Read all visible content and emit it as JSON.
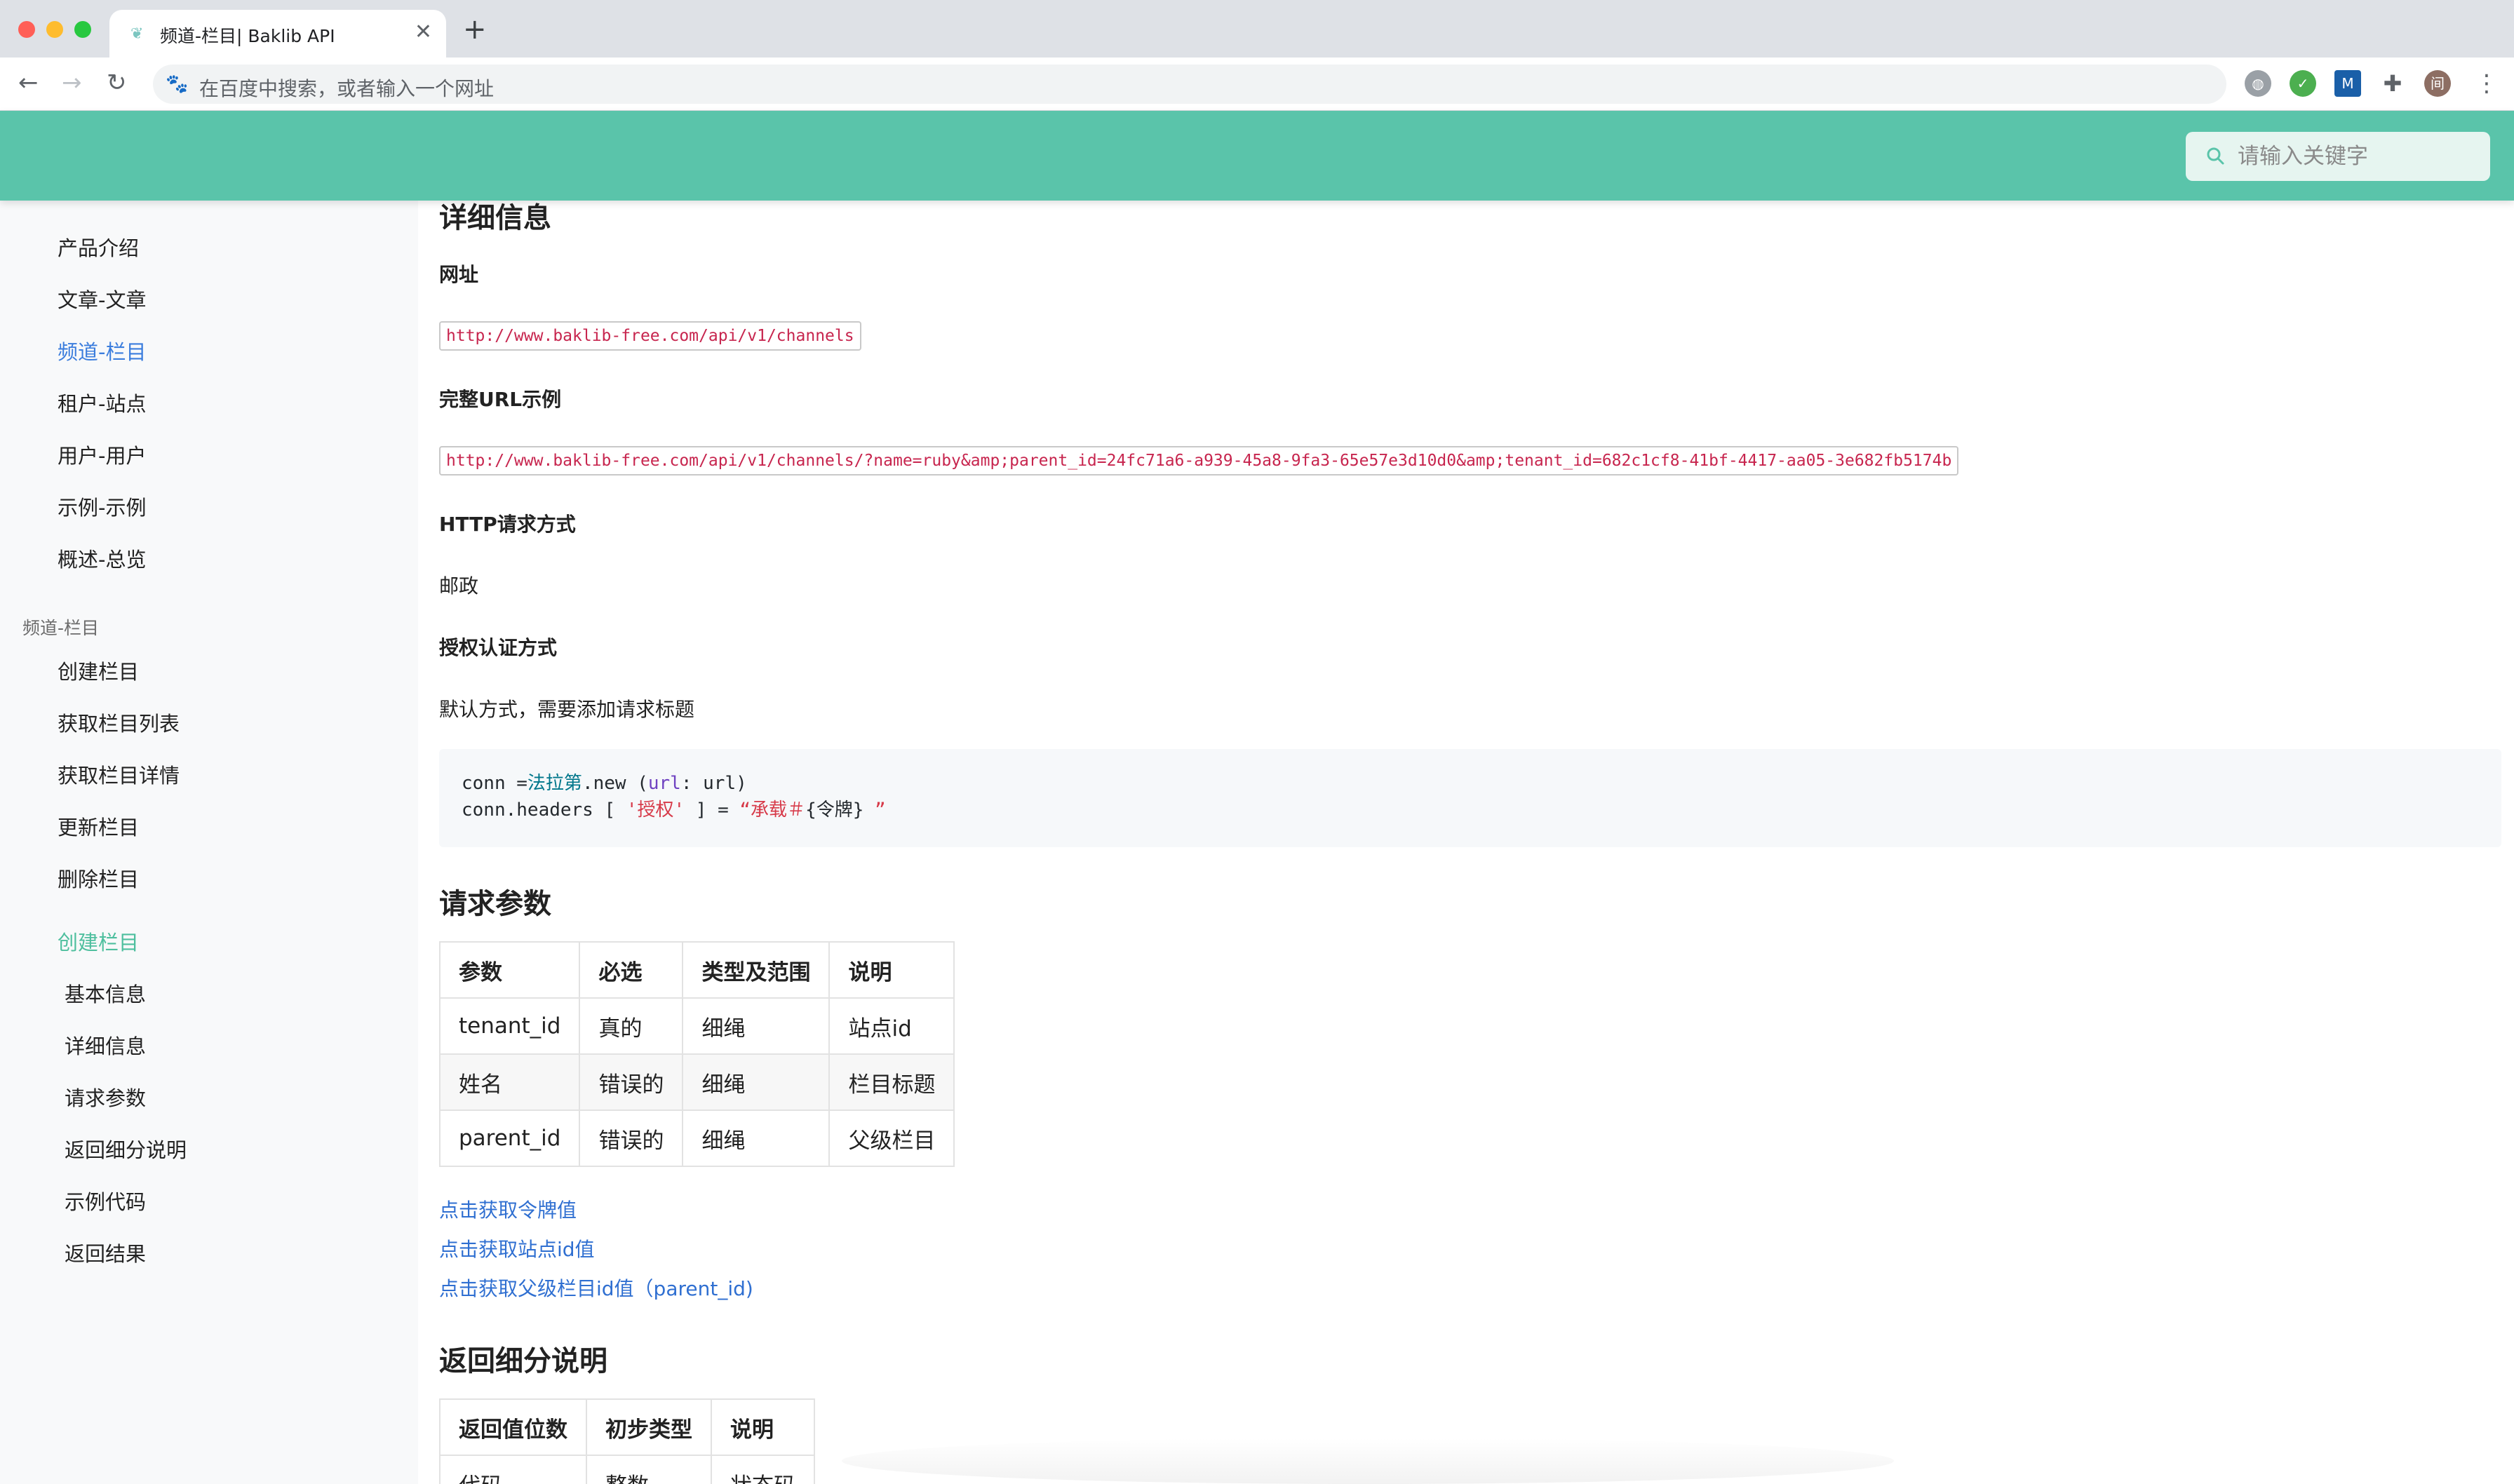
{
  "browser": {
    "tab_title": "频道-栏目| Baklib API",
    "tab_close": "✕",
    "new_tab": "+",
    "omnibox_placeholder": "在百度中搜索，或者输入一个网址",
    "profile_initial": "间"
  },
  "header": {
    "search_placeholder": "请输入关键字",
    "brand_color": "#5ac4aa"
  },
  "sidebar": {
    "top_items": [
      "产品介绍",
      "文章-文章",
      "频道-栏目",
      "租户-站点",
      "用户-用户",
      "示例-示例",
      "概述-总览"
    ],
    "active_item": "频道-栏目",
    "group_title": "频道-栏目",
    "group_items": [
      "创建栏目",
      "获取栏目列表",
      "获取栏目详情",
      "更新栏目",
      "删除栏目"
    ],
    "section_title": "创建栏目",
    "toc_items": [
      "基本信息",
      "详细信息",
      "请求参数",
      "返回细分说明",
      "示例代码",
      "返回结果"
    ]
  },
  "content": {
    "detail_heading": "详细信息",
    "url_label": "网址",
    "url_value": "http://www.baklib-free.com/api/v1/channels",
    "full_url_label": "完整URL示例",
    "full_url_value": "http://www.baklib-free.com/api/v1/channels/?name=ruby&amp;parent_id=24fc71a6-a939-45a8-9fa3-65e57e3d10d0&amp;tenant_id=682c1cf8-41bf-4417-aa05-3e682fb5174b",
    "http_method_label": "HTTP请求方式",
    "http_method_value": "邮政",
    "auth_label": "授权认证方式",
    "auth_value": "默认方式，需要添加请求标题",
    "code": {
      "l1_a": "conn =",
      "l1_cls": "法拉第",
      "l1_b": ".new (",
      "l1_key": "url",
      "l1_c": ": url)",
      "l2_a": "conn.headers [ ",
      "l2_str1": "'授权'",
      "l2_b": " ] = ",
      "l2_str2": "“承载＃",
      "l2_c": "{令牌}",
      "l2_str3": " ”"
    },
    "params_heading": "请求参数",
    "params_table": {
      "headers": [
        "参数",
        "必选",
        "类型及范围",
        "说明"
      ],
      "rows": [
        [
          "tenant_id",
          "真的",
          "细绳",
          "站点id"
        ],
        [
          "姓名",
          "错误的",
          "细绳",
          "栏目标题"
        ],
        [
          "parent_id",
          "错误的",
          "细绳",
          "父级栏目"
        ]
      ]
    },
    "links": [
      "点击获取令牌值",
      "点击获取站点id值",
      "点击获取父级栏目id值（parent_id)"
    ],
    "return_heading": "返回细分说明",
    "return_table": {
      "headers": [
        "返回值位数",
        "初步类型",
        "说明"
      ],
      "rows": [
        [
          "代码",
          "整数",
          "状态码"
        ]
      ]
    }
  }
}
